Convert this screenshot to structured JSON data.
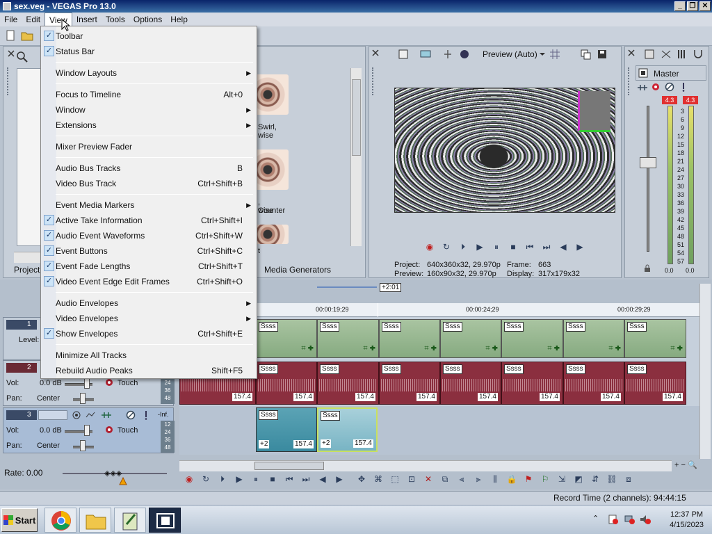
{
  "window": {
    "title": "sex.veg - VEGAS Pro 13.0"
  },
  "menubar": [
    "File",
    "Edit",
    "View",
    "Insert",
    "Tools",
    "Options",
    "Help"
  ],
  "view_menu": {
    "toolbar": "Toolbar",
    "status_bar": "Status Bar",
    "window_layouts": "Window Layouts",
    "focus_to_timeline": "Focus to Timeline",
    "focus_to_timeline_sc": "Alt+0",
    "window": "Window",
    "extensions": "Extensions",
    "mixer_preview_fader": "Mixer Preview Fader",
    "audio_bus_tracks": "Audio Bus Tracks",
    "audio_bus_tracks_sc": "B",
    "video_bus_track": "Video Bus Track",
    "video_bus_track_sc": "Ctrl+Shift+B",
    "event_media_markers": "Event Media Markers",
    "active_take_information": "Active Take Information",
    "active_take_information_sc": "Ctrl+Shift+I",
    "audio_event_waveforms": "Audio Event Waveforms",
    "audio_event_waveforms_sc": "Ctrl+Shift+W",
    "event_buttons": "Event Buttons",
    "event_buttons_sc": "Ctrl+Shift+C",
    "event_fade_lengths": "Event Fade Lengths",
    "event_fade_lengths_sc": "Ctrl+Shift+T",
    "video_event_edge_edit_frames": "Video Event Edge Edit Frames",
    "video_event_edge_edit_frames_sc": "Ctrl+Shift+O",
    "audio_envelopes": "Audio Envelopes",
    "video_envelopes": "Video Envelopes",
    "show_envelopes": "Show Envelopes",
    "show_envelopes_sc": "Ctrl+Shift+E",
    "minimize_all_tracks": "Minimize All Tracks",
    "rebuild_audio_peaks": "Rebuild Audio Peaks",
    "rebuild_audio_peaks_sc": "Shift+F5"
  },
  "explorer": {
    "item1_label": "Swirl,",
    "item1_sub": "wise",
    "item2_label": ", Counter",
    "item2_sub": "wise",
    "item3_label": "t",
    "tab_project": "Project",
    "tab_media_generators": "Media Generators"
  },
  "preview": {
    "mode": "Preview (Auto)",
    "project_label": "Project:",
    "project_value": "640x360x32, 29.970p",
    "preview_label": "Preview:",
    "preview_value": "160x90x32, 29.970p",
    "frame_label": "Frame:",
    "frame_value": "663",
    "display_label": "Display:",
    "display_value": "317x179x32"
  },
  "master": {
    "title": "Master",
    "peak_left": "4.3",
    "peak_right": "4.3",
    "scale": [
      "3",
      "6",
      "9",
      "12",
      "15",
      "18",
      "21",
      "24",
      "27",
      "30",
      "33",
      "36",
      "39",
      "42",
      "45",
      "48",
      "51",
      "54",
      "57"
    ],
    "level_left": "0.0",
    "level_right": "0.0"
  },
  "timeline": {
    "region_end": "+2:01",
    "ruler": [
      "00:00:19;29",
      "00:00:24;29",
      "00:00:29;29"
    ],
    "clip_title": "Ssss",
    "clip_length": "157.4",
    "offset": "+2",
    "rate": "Rate: 0.00"
  },
  "tracks": {
    "t1_num": "1",
    "t1_level": "Level:",
    "t2_num": "2",
    "t2_vol_label": "Vol:",
    "t2_vol_value": "0.0 dB",
    "t2_mode": "Touch",
    "t2_pan_label": "Pan:",
    "t2_pan_value": "Center",
    "t3_num": "3",
    "t3_inf": "-Inf.",
    "t3_vol_label": "Vol:",
    "t3_vol_value": "0.0 dB",
    "t3_mode": "Touch",
    "t3_pan_label": "Pan:",
    "t3_pan_value": "Center",
    "meter_scale_a": [
      "24",
      "36",
      "48"
    ],
    "meter_scale_b": [
      "12",
      "24",
      "36",
      "48"
    ]
  },
  "status": {
    "record_time": "Record Time (2 channels): 94:44:15"
  },
  "taskbar": {
    "start": "Start",
    "time": "12:37 PM",
    "date": "4/15/2023"
  }
}
